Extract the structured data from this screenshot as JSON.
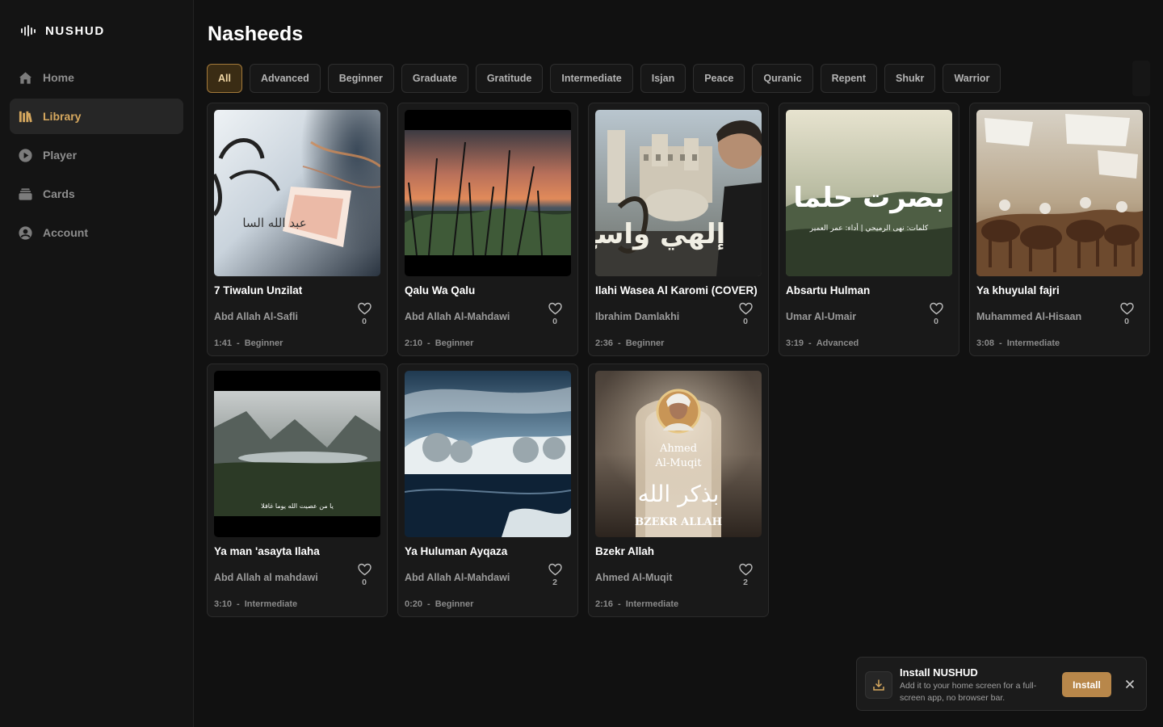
{
  "app": {
    "brand": "NUSHUD"
  },
  "sidebar": {
    "items": [
      {
        "label": "Home",
        "icon": "home-icon",
        "active": false
      },
      {
        "label": "Library",
        "icon": "library-icon",
        "active": true
      },
      {
        "label": "Player",
        "icon": "play-icon",
        "active": false
      },
      {
        "label": "Cards",
        "icon": "cards-icon",
        "active": false
      },
      {
        "label": "Account",
        "icon": "account-icon",
        "active": false
      }
    ]
  },
  "main": {
    "title": "Nasheeds",
    "filters": [
      "All",
      "Advanced",
      "Beginner",
      "Graduate",
      "Gratitude",
      "Intermediate",
      "Isjan",
      "Peace",
      "Quranic",
      "Repent",
      "Shukr",
      "Warrior"
    ],
    "active_filter": "All"
  },
  "cards": [
    {
      "title": "7 Tiwalun Unzilat",
      "artist": "Abd Allah Al-Safli",
      "duration": "1:41",
      "level": "Beginner",
      "likes": "0",
      "thumb_text": "عبد الله السا"
    },
    {
      "title": "Qalu Wa Qalu",
      "artist": "Abd Allah Al-Mahdawi",
      "duration": "2:10",
      "level": "Beginner",
      "likes": "0",
      "thumb_text": ""
    },
    {
      "title": "Ilahi Wasea Al Karomi (COVER)",
      "artist": "Ibrahim Damlakhi",
      "duration": "2:36",
      "level": "Beginner",
      "likes": "0",
      "thumb_text": "إلهي واسع"
    },
    {
      "title": "Absartu Hulman",
      "artist": "Umar Al-Umair",
      "duration": "3:19",
      "level": "Advanced",
      "likes": "0",
      "thumb_text": "بصرت حلما",
      "thumb_subtext": "كلمات: نهى الرميحي | أداء: عمر العمير"
    },
    {
      "title": "Ya khuyulal fajri",
      "artist": "Muhammed Al-Hisaan",
      "duration": "3:08",
      "level": "Intermediate",
      "likes": "0",
      "thumb_text": ""
    },
    {
      "title": "Ya man 'asayta Ilaha",
      "artist": "Abd Allah al mahdawi",
      "duration": "3:10",
      "level": "Intermediate",
      "likes": "0",
      "thumb_text": "يا من عصيت الله يوما غافلا"
    },
    {
      "title": "Ya Huluman Ayqaza",
      "artist": "Abd Allah Al-Mahdawi",
      "duration": "0:20",
      "level": "Beginner",
      "likes": "2",
      "thumb_text": ""
    },
    {
      "title": "Bzekr Allah",
      "artist": "Ahmed Al-Muqit",
      "duration": "2:16",
      "level": "Intermediate",
      "likes": "2",
      "thumb_text": "BZEKR ALLAH",
      "thumb_name_1": "Ahmed",
      "thumb_name_2": "Al-Muqit",
      "thumb_arabic": "بذكر الله"
    }
  ],
  "meta_separator": "-",
  "toast": {
    "title": "Install NUSHUD",
    "text": "Add it to your home screen for a full-screen app, no browser bar.",
    "button": "Install",
    "icon": "download-icon"
  },
  "colors": {
    "accent": "#d6a85f",
    "background": "#111111",
    "card": "#191919",
    "install_button": "#b8874a"
  }
}
